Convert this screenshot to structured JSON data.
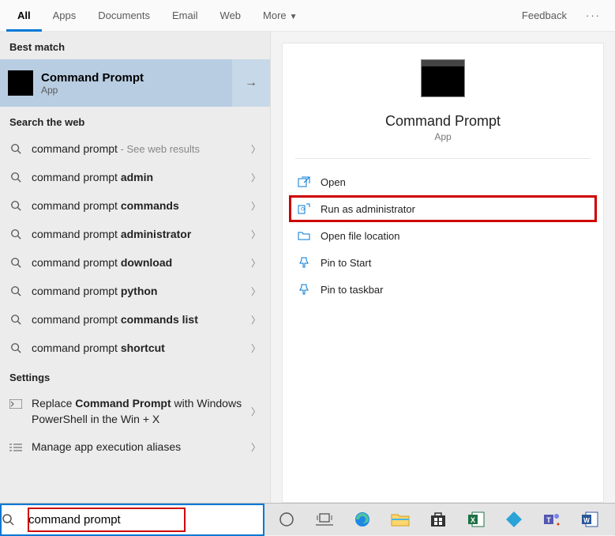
{
  "tabs": {
    "all": "All",
    "apps": "Apps",
    "documents": "Documents",
    "email": "Email",
    "web": "Web",
    "more": "More",
    "feedback": "Feedback"
  },
  "left": {
    "best_match_label": "Best match",
    "best_match": {
      "title": "Command Prompt",
      "subtitle": "App"
    },
    "search_web_label": "Search the web",
    "web_results": [
      {
        "prefix": "command prompt",
        "bold": "",
        "hint": " - See web results"
      },
      {
        "prefix": "command prompt ",
        "bold": "admin",
        "hint": ""
      },
      {
        "prefix": "command prompt ",
        "bold": "commands",
        "hint": ""
      },
      {
        "prefix": "command prompt ",
        "bold": "administrator",
        "hint": ""
      },
      {
        "prefix": "command prompt ",
        "bold": "download",
        "hint": ""
      },
      {
        "prefix": "command prompt ",
        "bold": "python",
        "hint": ""
      },
      {
        "prefix": "command prompt ",
        "bold": "commands list",
        "hint": ""
      },
      {
        "prefix": "command prompt ",
        "bold": "shortcut",
        "hint": ""
      }
    ],
    "settings_label": "Settings",
    "settings": [
      {
        "text_a": "Replace ",
        "text_b": "Command Prompt",
        "text_c": " with Windows PowerShell in the Win + X"
      },
      {
        "text_a": "Manage app execution aliases",
        "text_b": "",
        "text_c": ""
      }
    ]
  },
  "right": {
    "title": "Command Prompt",
    "subtitle": "App",
    "actions": {
      "open": "Open",
      "run_admin": "Run as administrator",
      "open_loc": "Open file location",
      "pin_start": "Pin to Start",
      "pin_taskbar": "Pin to taskbar"
    }
  },
  "taskbar": {
    "search_value": "command prompt"
  }
}
